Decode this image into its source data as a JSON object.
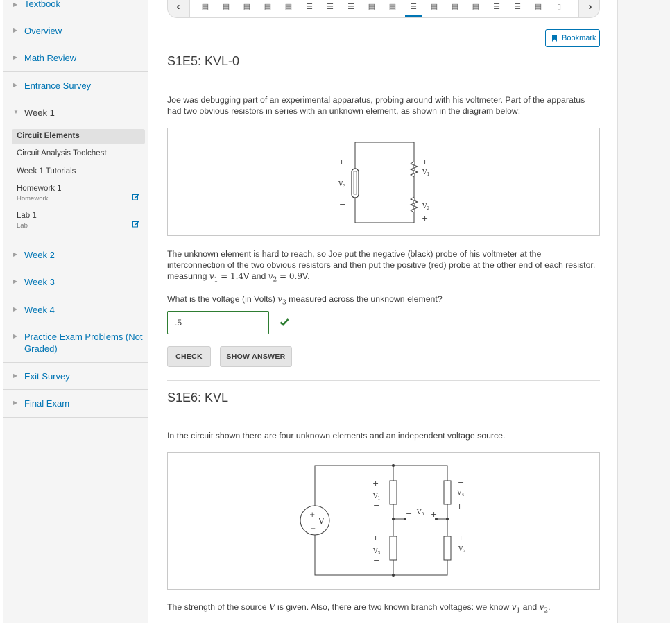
{
  "sidebar": {
    "chapters": [
      {
        "label": "Textbook"
      },
      {
        "label": "Overview"
      },
      {
        "label": "Math Review"
      },
      {
        "label": "Entrance Survey"
      },
      {
        "label": "Week 1"
      },
      {
        "label": "Week 2"
      },
      {
        "label": "Week 3"
      },
      {
        "label": "Week 4"
      },
      {
        "label": "Practice Exam Problems (Not Graded)"
      },
      {
        "label": "Exit Survey"
      },
      {
        "label": "Final Exam"
      }
    ],
    "week1_sections": [
      {
        "label": "Circuit Elements",
        "active": true
      },
      {
        "label": "Circuit Analysis Toolchest"
      },
      {
        "label": "Week 1 Tutorials"
      },
      {
        "label": "Homework 1",
        "format": "Homework"
      },
      {
        "label": "Lab 1",
        "format": "Lab"
      }
    ]
  },
  "sequence_nav": {
    "prev_label": "‹",
    "next_label": "›",
    "items": [
      "video",
      "video",
      "video",
      "video",
      "video",
      "problem",
      "problem",
      "problem",
      "video",
      "video",
      "problem-active",
      "video",
      "video",
      "video",
      "problem",
      "problem",
      "video",
      "page"
    ]
  },
  "bookmark_label": "Bookmark",
  "problem1": {
    "title": "S1E5: KVL-0",
    "intro": "Joe was debugging part of an experimental apparatus, probing around with his voltmeter. Part of the apparatus had two obvious resistors in series with an unknown element, as shown in the diagram below:",
    "body_part1": "The unknown element is hard to reach, so Joe put the negative (black) probe of his voltmeter at the interconnection of the two obvious resistors and then put the positive (red) probe at the other end of each resistor, measuring ",
    "v1_sym": "v",
    "v1_sub": "1",
    "v1_val": " = 1.4",
    "v1_unit": "V",
    "and_text": " and ",
    "v2_sym": "v",
    "v2_sub": "2",
    "v2_val": " = 0.9",
    "v2_unit": "V",
    "body_end": ".",
    "question_pre": "What is the voltage (in Volts) ",
    "v3_sym": "v",
    "v3_sub": "3",
    "question_post": " measured across the unknown element?",
    "answer_value": ".5",
    "check_label": "CHECK",
    "show_answer_label": "SHOW ANSWER",
    "diagram_labels": {
      "v1": "V",
      "v1_sub": "1",
      "v2": "V",
      "v2_sub": "2",
      "v3": "V",
      "v3_sub": "3",
      "plus": "+",
      "minus": "−"
    }
  },
  "problem2": {
    "title": "S1E6: KVL",
    "intro": "In the circuit shown there are four unknown elements and an independent voltage source.",
    "body_pre": "The strength of the source ",
    "V_sym": "V",
    "body_mid": " is given. Also, there are two known branch voltages: we know ",
    "v1_sym": "v",
    "v1_sub": "1",
    "and_text": " and ",
    "v2_sym": "v",
    "v2_sub": "2",
    "body_end": ".",
    "diagram_labels": {
      "source": "V",
      "v": "V",
      "s1": "1",
      "s2": "2",
      "s3": "3",
      "s4": "4",
      "s5": "5",
      "plus": "+",
      "minus": "−"
    }
  },
  "colors": {
    "link": "#0075b4",
    "correct": "#2e7d32",
    "sidebar_bg": "#f5f5f5"
  }
}
